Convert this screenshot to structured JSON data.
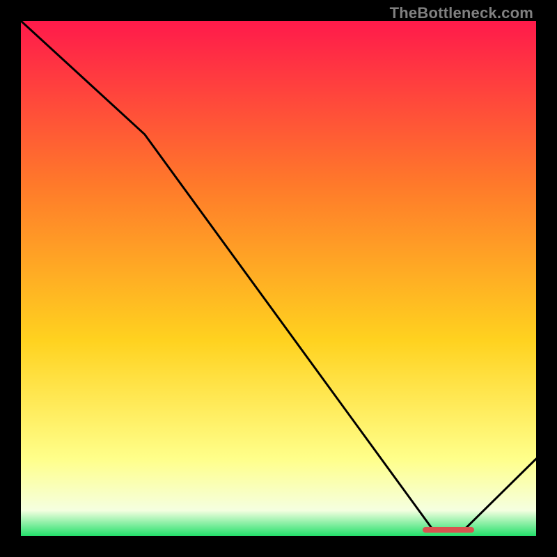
{
  "watermark": "TheBottleneck.com",
  "colors": {
    "bg": "#000000",
    "grad_top": "#ff1a4b",
    "grad_upper_mid": "#ff7a2a",
    "grad_mid": "#ffd21f",
    "grad_lower_mid": "#ffff8a",
    "grad_bottom_pale": "#f5ffe0",
    "grad_bottom": "#22e06a",
    "line": "#000000",
    "marker": "#d9534f"
  },
  "chart_data": {
    "type": "line",
    "x": [
      0.0,
      0.24,
      0.8,
      0.86,
      1.0
    ],
    "values": [
      1.0,
      0.78,
      0.012,
      0.012,
      0.15
    ],
    "title": "",
    "xlabel": "",
    "ylabel": "",
    "xlim": [
      0,
      1
    ],
    "ylim": [
      0,
      1
    ],
    "marker": {
      "x_start": 0.78,
      "x_end": 0.88,
      "y": 0.012
    }
  }
}
